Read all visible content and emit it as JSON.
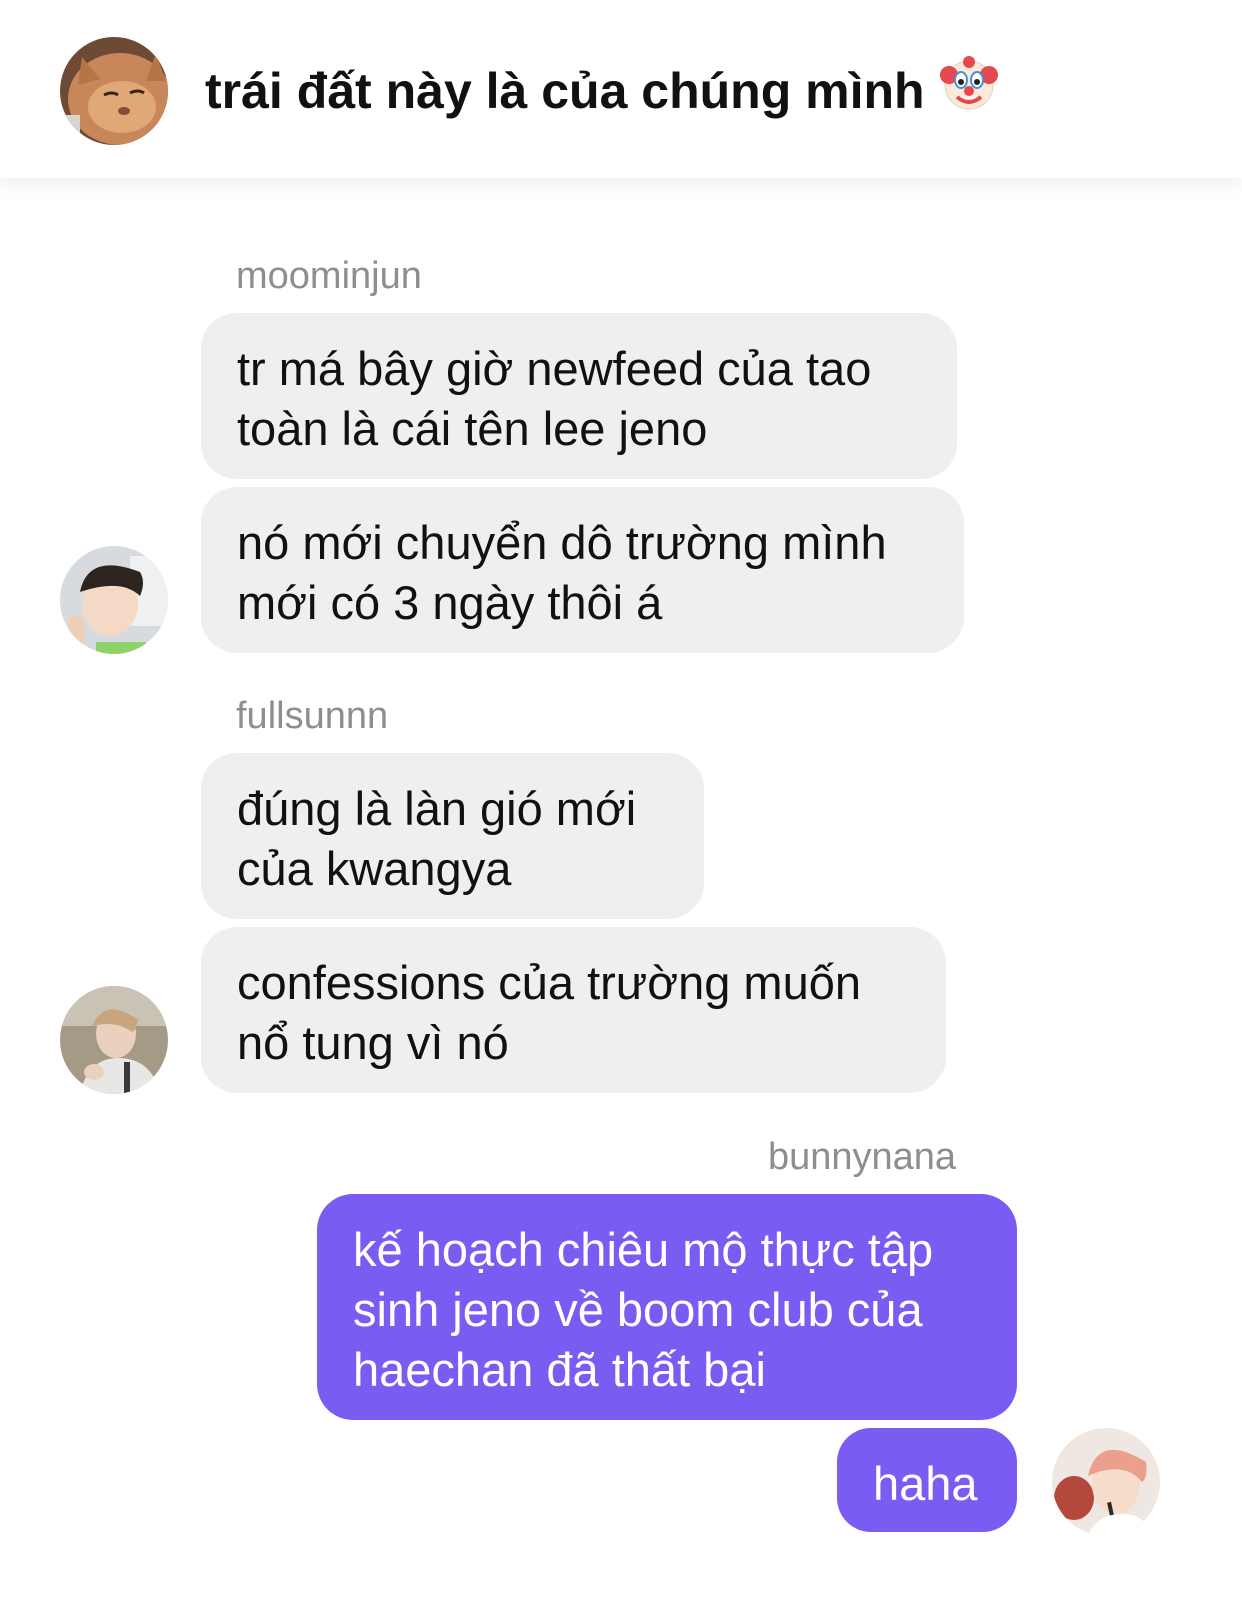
{
  "header": {
    "title": "trái đất này là của chúng mình",
    "title_emoji": "clown-face-icon",
    "avatar": "cat-avatar"
  },
  "messages": {
    "group1": {
      "sender": "moominjun",
      "bubble1": "tr má bây giờ newfeed của tao\ntoàn là cái tên lee jeno",
      "bubble2": "nó mới chuyển dô trường mình\nmới có 3 ngày thôi á"
    },
    "group2": {
      "sender": "fullsunnn",
      "bubble1": "đúng là làn gió mới\ncủa kwangya",
      "bubble2": "confessions của trường muốn\nnổ tung vì nó"
    },
    "group3": {
      "sender": "bunnynana",
      "bubble1": "kế hoạch chiêu mộ thực tập\nsinh jeno về boom club của\nhaechan đã thất bại",
      "bubble2": "haha"
    }
  },
  "colors": {
    "incoming_bubble": "#efefef",
    "outgoing_bubble": "#7a5cf2",
    "sender_name": "#8e8e8e",
    "text": "#111111"
  }
}
